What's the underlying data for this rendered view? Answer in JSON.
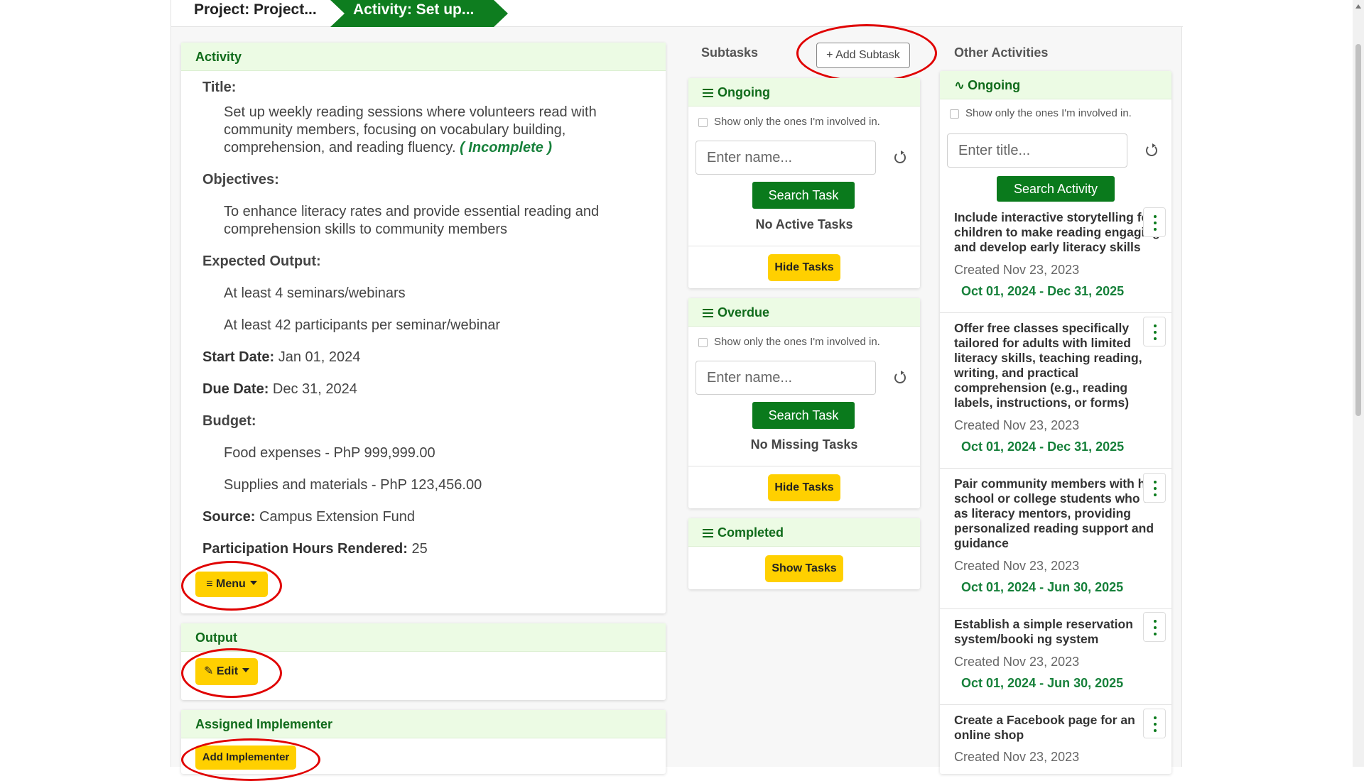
{
  "breadcrumb": {
    "project": "Project: Project...",
    "activity": "Activity: Set up..."
  },
  "activity_card": {
    "header": "Activity",
    "title_label": "Title:",
    "title_lines": [
      "Set up weekly reading sessions where volunteers read with",
      "community members, focusing on vocabulary building,",
      "comprehension, and reading fluency."
    ],
    "status": "( Incomplete )",
    "objectives_label": "Objectives:",
    "objectives_lines": [
      "To enhance literacy rates and provide essential reading and",
      "comprehension skills to community members"
    ],
    "expected_output_label": "Expected Output:",
    "outputs": [
      "At least 4 seminars/webinars",
      "At least 42 participants per seminar/webinar"
    ],
    "start_label": "Start Date:",
    "start_value": "Jan 01, 2024",
    "due_label": "Due Date:",
    "due_value": "Dec 31, 2024",
    "budget_label": "Budget:",
    "budget_items": [
      "Food expenses - PhP 999,999.00",
      "Supplies and materials - PhP 123,456.00"
    ],
    "source_label": "Source:",
    "source_value": "Campus Extension Fund",
    "hours_label": "Participation Hours Rendered:",
    "hours_value": "25",
    "menu_button": "Menu"
  },
  "output_card": {
    "header": "Output",
    "edit_button": "Edit"
  },
  "implementer_card": {
    "header": "Assigned Implementer",
    "add_button": "Add Implementer"
  },
  "subtasks": {
    "label": "Subtasks",
    "add_button": "Add Subtask",
    "ongoing": {
      "header": "Ongoing",
      "checkbox_label": "Show only the ones I'm involved in.",
      "placeholder": "Enter name...",
      "search_button": "Search Task",
      "empty": "No Active Tasks",
      "toggle_button": "Hide Tasks"
    },
    "overdue": {
      "header": "Overdue",
      "checkbox_label": "Show only the ones I'm involved in.",
      "placeholder": "Enter name...",
      "search_button": "Search Task",
      "empty": "No Missing Tasks",
      "toggle_button": "Hide Tasks"
    },
    "completed": {
      "header": "Completed",
      "toggle_button": "Show Tasks"
    }
  },
  "other_activities": {
    "label": "Other Activities",
    "header": "Ongoing",
    "checkbox_label": "Show only the ones I'm involved in.",
    "placeholder": "Enter title...",
    "search_button": "Search Activity",
    "items": [
      {
        "title_lines": [
          "Include interactive storytelling for",
          "children to make reading engaging",
          "and develop early literacy skills"
        ],
        "created": "Created Nov 23, 2023",
        "range": "Oct 01, 2024 - Dec 31, 2025"
      },
      {
        "title_lines": [
          "Offer free classes specifically",
          "tailored for adults with limited",
          "literacy skills, teaching reading,",
          "writing, and practical",
          "comprehension (e.g., reading",
          "labels, instructions, or forms)"
        ],
        "created": "Created Nov 23, 2023",
        "range": "Oct 01, 2024 - Dec 31, 2025"
      },
      {
        "title_lines": [
          "Pair community members with high",
          "school or college students who act",
          "as literacy mentors, providing",
          "personalized reading support and",
          "guidance"
        ],
        "created": "Created Nov 23, 2023",
        "range": "Oct 01, 2024 - Jun 30, 2025"
      },
      {
        "title_lines": [
          "Establish a simple reservation",
          "system/booki ng system"
        ],
        "created": "Created Nov 23, 2023",
        "range": "Oct 01, 2024 - Jun 30, 2025"
      },
      {
        "title_lines": [
          "Create a Facebook page for an",
          "online shop"
        ],
        "created": "Created Nov 23, 2023",
        "range": ""
      }
    ]
  },
  "colors": {
    "brand_green": "#0a7a1c",
    "header_bg": "#ecfbe4",
    "accent_yellow": "#ffd000",
    "highlight_ring": "#e00000"
  }
}
